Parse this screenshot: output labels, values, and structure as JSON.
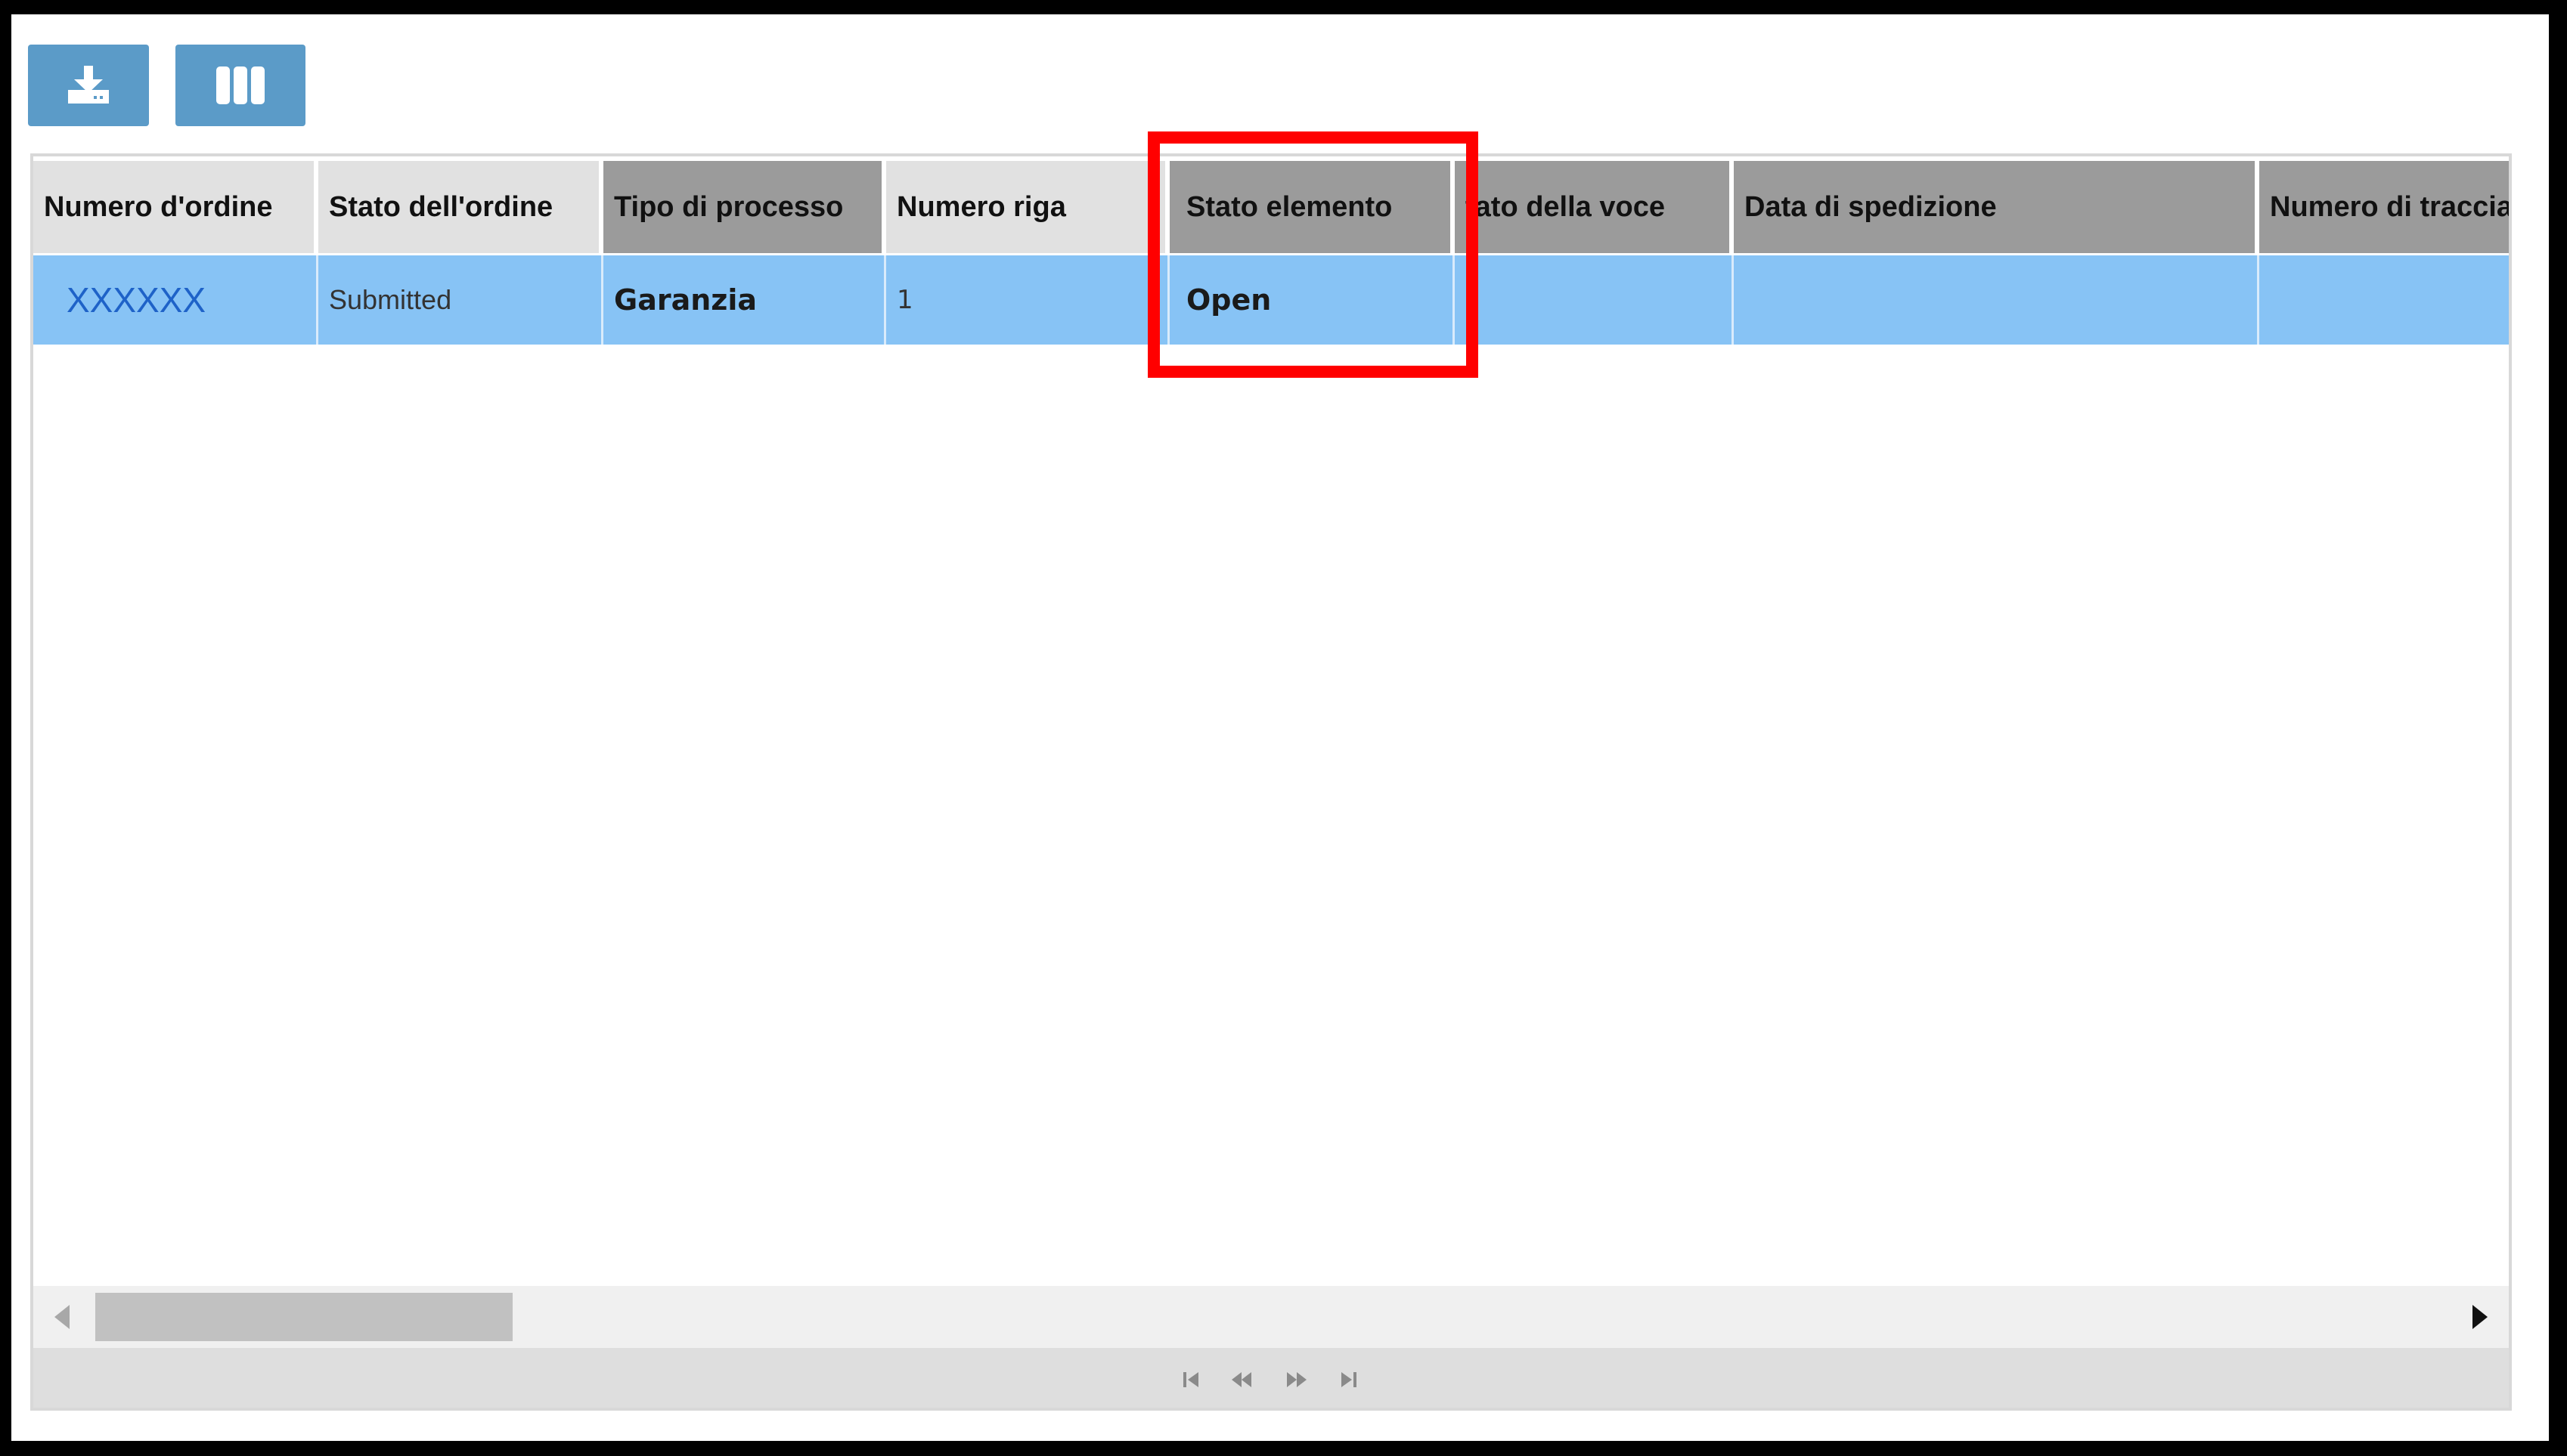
{
  "toolbar": {
    "download_icon": "download-icon",
    "columns_icon": "columns-icon",
    "button_color": "#5b9bc8"
  },
  "grid": {
    "columns": [
      "Numero d'ordine",
      "Stato dell'ordine",
      "Tipo di processo",
      "Numero riga",
      "Stato elemento",
      "tato della voce",
      "Data di spedizione",
      "Numero di traccia"
    ],
    "rows": [
      [
        "XXXXXX",
        "Submitted",
        "Garanzia",
        "1",
        "Open",
        "",
        "",
        ""
      ]
    ],
    "selected_row_color": "#87c3f5"
  },
  "scrollbar": {
    "left_arrow_icon": "arrow-left-icon",
    "right_arrow_icon": "arrow-right-icon"
  },
  "pager": {
    "icons": [
      "first-page-icon",
      "prev-page-icon",
      "next-page-icon",
      "last-page-icon"
    ]
  },
  "annotation": {
    "highlight_color": "#ff0000",
    "highlighted_column": "Stato elemento"
  }
}
